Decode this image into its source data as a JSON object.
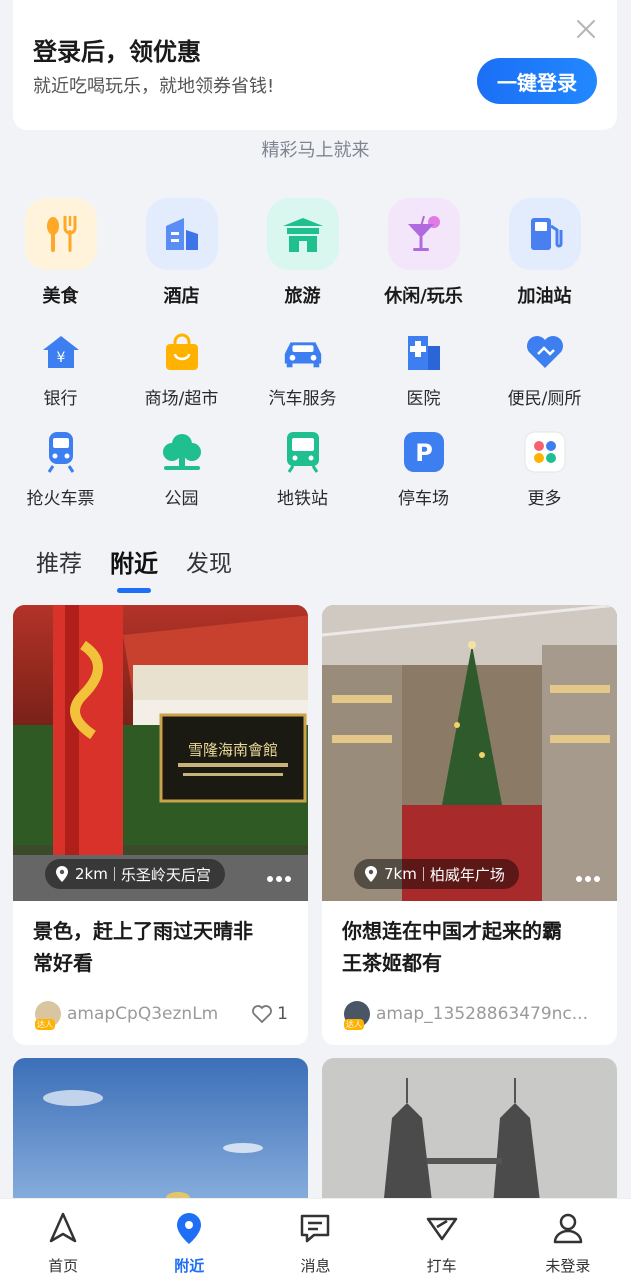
{
  "login": {
    "title": "登录后，领优惠",
    "subtitle": "就近吃喝玩乐，就地领券省钱!",
    "button": "一键登录"
  },
  "coming_soon": "精彩马上就来",
  "categories_main": [
    {
      "label": "美食",
      "icon": "food-icon"
    },
    {
      "label": "酒店",
      "icon": "hotel-icon"
    },
    {
      "label": "旅游",
      "icon": "travel-icon"
    },
    {
      "label": "休闲/玩乐",
      "icon": "cocktail-icon"
    },
    {
      "label": "加油站",
      "icon": "gas-station-icon"
    }
  ],
  "categories_row2": [
    {
      "label": "银行",
      "icon": "bank-icon"
    },
    {
      "label": "商场/超市",
      "icon": "shopping-bag-icon"
    },
    {
      "label": "汽车服务",
      "icon": "car-icon"
    },
    {
      "label": "医院",
      "icon": "hospital-icon"
    },
    {
      "label": "便民/厕所",
      "icon": "heart-hand-icon"
    }
  ],
  "categories_row3": [
    {
      "label": "抢火车票",
      "icon": "train-icon"
    },
    {
      "label": "公园",
      "icon": "tree-icon"
    },
    {
      "label": "地铁站",
      "icon": "subway-icon"
    },
    {
      "label": "停车场",
      "icon": "parking-icon"
    },
    {
      "label": "更多",
      "icon": "more-apps-icon"
    }
  ],
  "tabs": [
    "推荐",
    "附近",
    "发现"
  ],
  "active_tab": "附近",
  "feed": [
    {
      "distance": "2km",
      "place": "乐圣岭天后宫",
      "title_line1": "景色，赶上了雨过天晴非",
      "title_line2": "常好看",
      "author": "amapCpQ3eznLm",
      "likes": "1",
      "badge": "达人"
    },
    {
      "distance": "7km",
      "place": "柏威年广场",
      "title_line1": "你想连在中国才起来的霸",
      "title_line2": "王茶姬都有",
      "author": "amap_13528863479nc...",
      "badge": "达人"
    }
  ],
  "bottom_nav": [
    {
      "label": "首页",
      "icon": "navigation-arrow-icon"
    },
    {
      "label": "附近",
      "icon": "location-pin-icon"
    },
    {
      "label": "消息",
      "icon": "message-icon"
    },
    {
      "label": "打车",
      "icon": "taxi-icon"
    },
    {
      "label": "未登录",
      "icon": "user-icon"
    }
  ],
  "colors": {
    "accent": "#1e6ff5",
    "background": "#f2f3f7"
  }
}
